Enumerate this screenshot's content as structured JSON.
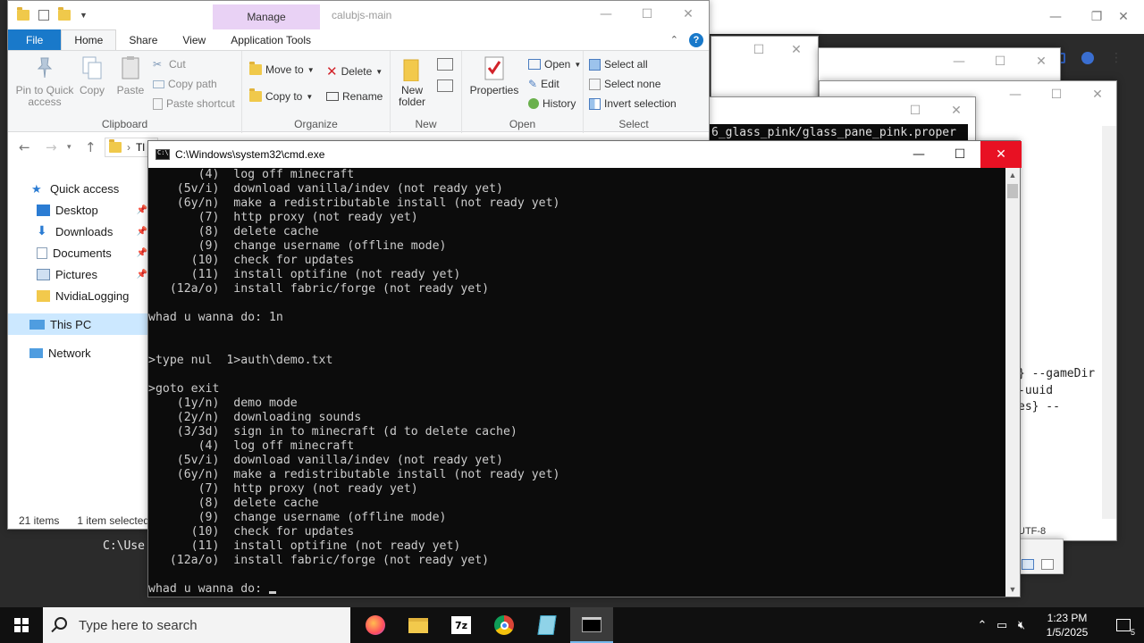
{
  "explorer": {
    "manage_tab": "Manage",
    "title": "calubjs-main",
    "tabs": [
      "File",
      "Home",
      "Share",
      "View",
      "Application Tools"
    ],
    "clipboard": {
      "pin": "Pin to Quick access",
      "copy": "Copy",
      "paste": "Paste",
      "cut": "Cut",
      "copy_path": "Copy path",
      "paste_shortcut": "Paste shortcut",
      "label": "Clipboard"
    },
    "organize": {
      "move_to": "Move to",
      "copy_to": "Copy to",
      "delete": "Delete",
      "rename": "Rename",
      "label": "Organize"
    },
    "new": {
      "new_folder": "New folder",
      "label": "New"
    },
    "open": {
      "properties": "Properties",
      "open": "Open",
      "edit": "Edit",
      "history": "History",
      "label": "Open"
    },
    "select": {
      "select_all": "Select all",
      "select_none": "Select none",
      "invert": "Invert selection",
      "label": "Select"
    },
    "address_fragment": "Tl",
    "nav": [
      "Quick access",
      "Desktop",
      "Downloads",
      "Documents",
      "Pictures",
      "NvidiaLogging",
      "This PC",
      "Network"
    ],
    "status": {
      "items": "21 items",
      "selected": "1 item selected"
    }
  },
  "background": {
    "path_fragment": "6_glass_pink/glass_pane_pink.proper",
    "right_text": [
      "} --gameDir",
      "-uuid",
      "es} --"
    ],
    "encoding": "UTF-8",
    "prompt_fragment": "C:\\Use"
  },
  "cmd": {
    "title": "C:\\Windows\\system32\\cmd.exe",
    "lines": [
      "       (4)  log off minecraft",
      "    (5v/i)  download vanilla/indev (not ready yet)",
      "    (6y/n)  make a redistributable install (not ready yet)",
      "       (7)  http proxy (not ready yet)",
      "       (8)  delete cache",
      "       (9)  change username (offline mode)",
      "      (10)  check for updates",
      "      (11)  install optifine (not ready yet)",
      "   (12a/o)  install fabric/forge (not ready yet)",
      "",
      "whad u wanna do: 1n",
      "",
      "",
      ">type nul  1>auth\\demo.txt",
      "",
      ">goto exit",
      "    (1y/n)  demo mode",
      "    (2y/n)  downloading sounds",
      "    (3/3d)  sign in to minecraft (d to delete cache)",
      "       (4)  log off minecraft",
      "    (5v/i)  download vanilla/indev (not ready yet)",
      "    (6y/n)  make a redistributable install (not ready yet)",
      "       (7)  http proxy (not ready yet)",
      "       (8)  delete cache",
      "       (9)  change username (offline mode)",
      "      (10)  check for updates",
      "      (11)  install optifine (not ready yet)",
      "   (12a/o)  install fabric/forge (not ready yet)",
      "",
      "whad u wanna do: "
    ]
  },
  "taskbar": {
    "search_placeholder": "Type here to search",
    "apps": [
      "firefox-icon",
      "file-explorer-icon",
      "7zip-icon",
      "chrome-icon",
      "notepad-icon",
      "cmd-icon"
    ],
    "time": "1:23 PM",
    "date": "1/5/2025",
    "notification_count": "5"
  },
  "colors": {
    "accent": "#1979ca",
    "manage_tab": "#e9d2f5",
    "close_red": "#e81123",
    "console_bg": "#0c0c0c",
    "console_fg": "#cccccc",
    "taskbar": "#101010"
  }
}
